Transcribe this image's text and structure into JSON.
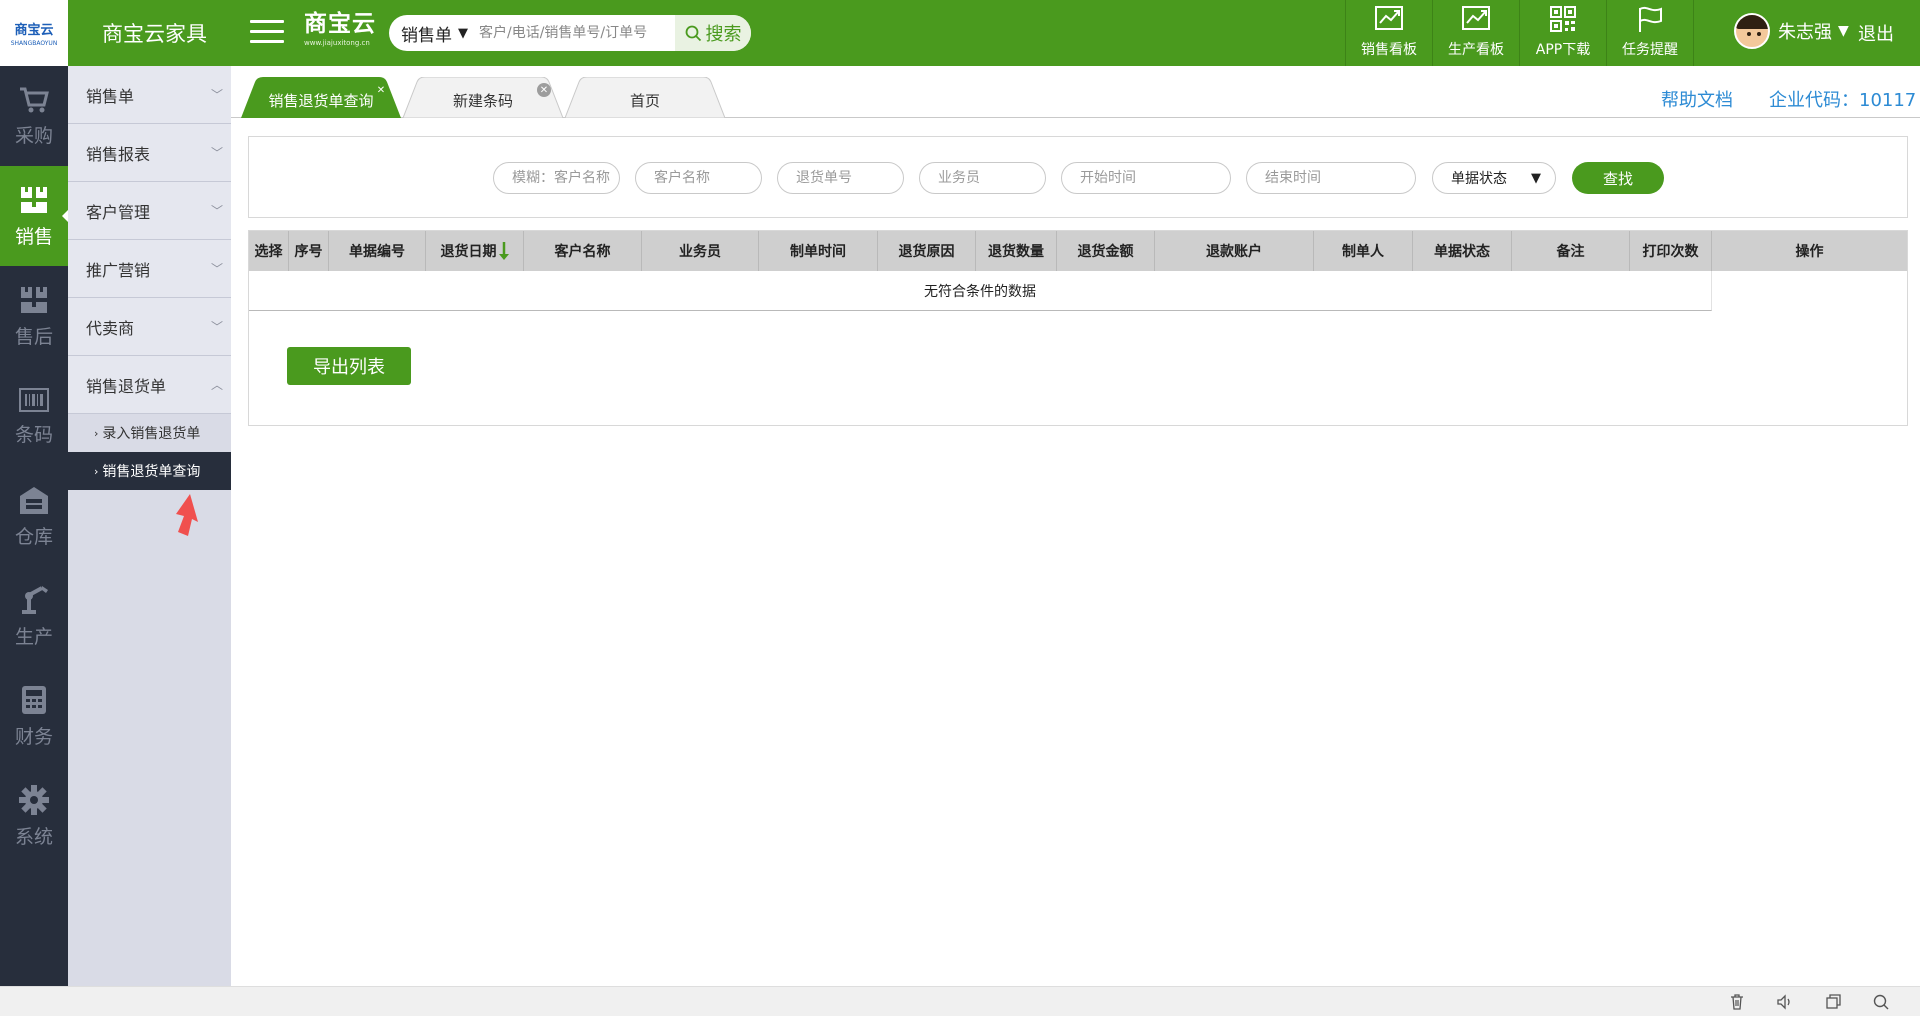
{
  "logo": {
    "main": "商宝云",
    "sub": "SHANGBAOYUN"
  },
  "company_name": "商宝云家具",
  "brand": {
    "name": "商宝云",
    "url": "www.jiajuxitong.cn"
  },
  "search": {
    "type": "销售单",
    "placeholder": "客户/电话/销售单号/订单号",
    "button": "搜索"
  },
  "top_actions": [
    {
      "label": "销售看板",
      "icon": "chart-icon"
    },
    {
      "label": "生产看板",
      "icon": "chart-icon"
    },
    {
      "label": "APP下载",
      "icon": "qrcode-icon"
    },
    {
      "label": "任务提醒",
      "icon": "flag-icon"
    }
  ],
  "user": {
    "name": "朱志强",
    "logout": "退出"
  },
  "rail": [
    {
      "label": "采购",
      "icon": "cart-icon"
    },
    {
      "label": "销售",
      "icon": "boxes-icon",
      "active": true
    },
    {
      "label": "售后",
      "icon": "boxes-icon"
    },
    {
      "label": "条码",
      "icon": "barcode-icon"
    },
    {
      "label": "仓库",
      "icon": "warehouse-icon"
    },
    {
      "label": "生产",
      "icon": "robot-arm-icon"
    },
    {
      "label": "财务",
      "icon": "calculator-icon"
    },
    {
      "label": "系统",
      "icon": "gear-icon"
    }
  ],
  "submenu": {
    "items": [
      "销售单",
      "销售报表",
      "客户管理",
      "推广营销",
      "代卖商",
      "销售退货单"
    ],
    "children": [
      "录入销售退货单",
      "销售退货单查询"
    ]
  },
  "tabs": [
    {
      "label": "销售退货单查询",
      "active": true
    },
    {
      "label": "新建条码"
    },
    {
      "label": "首页"
    }
  ],
  "header_links": {
    "help": "帮助文档",
    "corp_code": "企业代码：10117"
  },
  "filters": {
    "fuzzy_placeholder": "模糊：客户名称",
    "customer_placeholder": "客户名称",
    "return_no_placeholder": "退货单号",
    "salesman_placeholder": "业务员",
    "start_placeholder": "开始时间",
    "end_placeholder": "结束时间",
    "status_select": "单据状态",
    "search_button": "查找"
  },
  "table": {
    "columns": [
      "选择",
      "序号",
      "单据编号",
      "退货日期",
      "客户名称",
      "业务员",
      "制单时间",
      "退货原因",
      "退货数量",
      "退货金额",
      "退款账户",
      "制单人",
      "单据状态",
      "备注",
      "打印次数",
      "操作"
    ],
    "empty_text": "无符合条件的数据"
  },
  "export_button": "导出列表",
  "colors": {
    "primary": "#4a9a1e",
    "rail_bg": "#272e3c",
    "link": "#2d8bd4"
  }
}
